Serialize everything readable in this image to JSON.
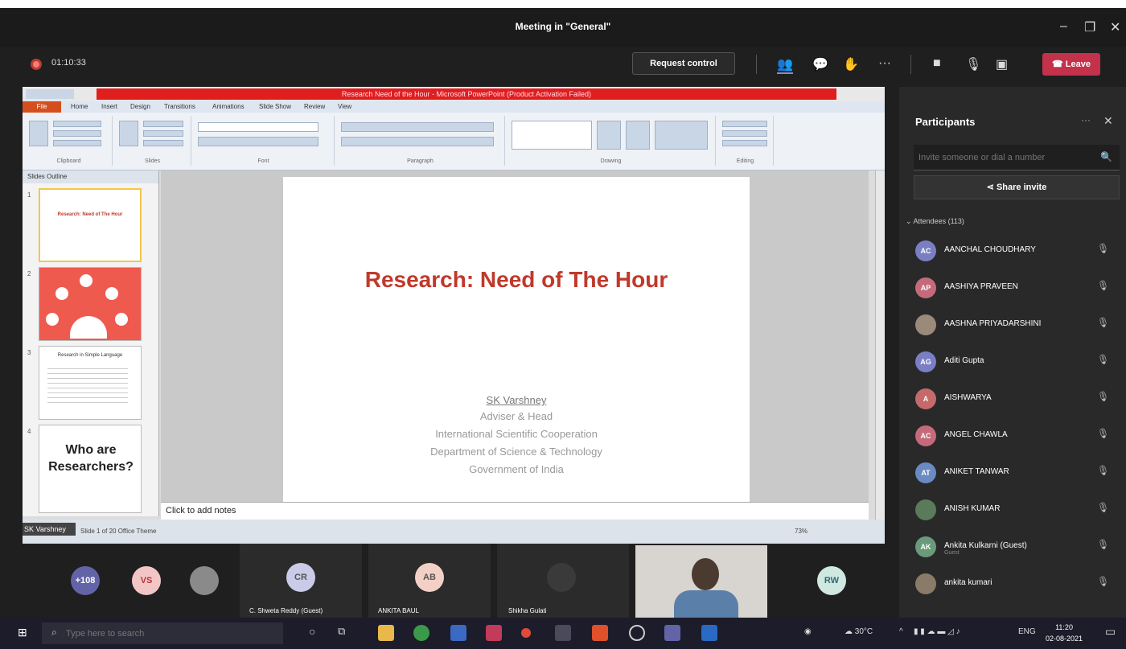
{
  "window": {
    "title": "Meeting in \"General\"",
    "minimize": "–",
    "restore": "❐",
    "close": "✕"
  },
  "toolbar": {
    "timer": "01:10:33",
    "request_control": "Request control",
    "more": "···",
    "leave": "Leave"
  },
  "ppt": {
    "title": "Research Need of the Hour - Microsoft PowerPoint (Product Activation Failed)",
    "file_tab": "File",
    "tabs": [
      "Home",
      "Insert",
      "Design",
      "Transitions",
      "Animations",
      "Slide Show",
      "Review",
      "View"
    ],
    "ribbon_groups": [
      "Clipboard",
      "Slides",
      "Font",
      "Paragraph",
      "Drawing",
      "Editing"
    ],
    "side_tabs": "Slides   Outline",
    "thumbs": [
      {
        "num": "1",
        "text": "Research: Need of The Hour"
      },
      {
        "num": "2",
        "text": ""
      },
      {
        "num": "3",
        "text": "Research in Simple Language"
      },
      {
        "num": "4",
        "text": "Who are Researchers?"
      }
    ],
    "slide": {
      "title": "Research: Need of The Hour",
      "presenter": "SK Varshney",
      "role": "Adviser & Head",
      "dept1": "International Scientific Cooperation",
      "dept2": "Department of Science & Technology",
      "govt": "Government of India"
    },
    "notes": "Click to add notes",
    "status": "Slide 1 of 20    Office Theme",
    "zoom": "73%"
  },
  "presenter_label": "SK Varshney",
  "participants": {
    "title": "Participants",
    "invite_placeholder": "Invite someone or dial a number",
    "share_invite": "Share invite",
    "attendees_header": "Attendees (113)",
    "list": [
      {
        "initials": "AC",
        "name": "AANCHAL CHOUDHARY",
        "sub": "",
        "color": "#7a7fc4"
      },
      {
        "initials": "AP",
        "name": "AASHIYA PRAVEEN",
        "sub": "",
        "color": "#c46a7a"
      },
      {
        "initials": "",
        "name": "AASHNA PRIYADARSHINI",
        "sub": "",
        "color": "#9a8a7a"
      },
      {
        "initials": "AG",
        "name": "Aditi Gupta",
        "sub": "",
        "color": "#7a7fc4"
      },
      {
        "initials": "A",
        "name": "AISHWARYA",
        "sub": "",
        "color": "#c46a6a"
      },
      {
        "initials": "AC",
        "name": "ANGEL CHAWLA",
        "sub": "",
        "color": "#c46a7a"
      },
      {
        "initials": "AT",
        "name": "ANIKET TANWAR",
        "sub": "",
        "color": "#6a8ac4"
      },
      {
        "initials": "",
        "name": "ANISH KUMAR",
        "sub": "",
        "color": "#5a7a5a"
      },
      {
        "initials": "AK",
        "name": "Ankita Kulkarni (Guest)",
        "sub": "Guest",
        "color": "#6a9a7a"
      },
      {
        "initials": "",
        "name": "ankita kumari",
        "sub": "",
        "color": "#8a7a6a"
      }
    ]
  },
  "gallery": {
    "overflow": "+108",
    "tiles": [
      {
        "initials": "VS",
        "name": "",
        "color": "#f3c6c6",
        "text_color": "#b33"
      },
      {
        "initials": "",
        "name": "",
        "color": "#8a8a8a",
        "text_color": "#fff"
      },
      {
        "initials": "CR",
        "name": "C. Shweta Reddy (Guest)",
        "color": "#c9cbe8",
        "text_color": "#555"
      },
      {
        "initials": "AB",
        "name": "ANKITA BAUL",
        "color": "#f3d0c6",
        "text_color": "#555"
      },
      {
        "initials": "",
        "name": "Shikha Gulati",
        "color": "#3a3a3a",
        "text_color": "#fff"
      },
      {
        "initials": "RW",
        "name": "",
        "color": "#cfe8e0",
        "text_color": "#367"
      }
    ]
  },
  "taskbar": {
    "search_placeholder": "Type here to search",
    "weather": "30°C",
    "lang": "ENG",
    "time": "11:20",
    "date": "02-08-2021"
  }
}
